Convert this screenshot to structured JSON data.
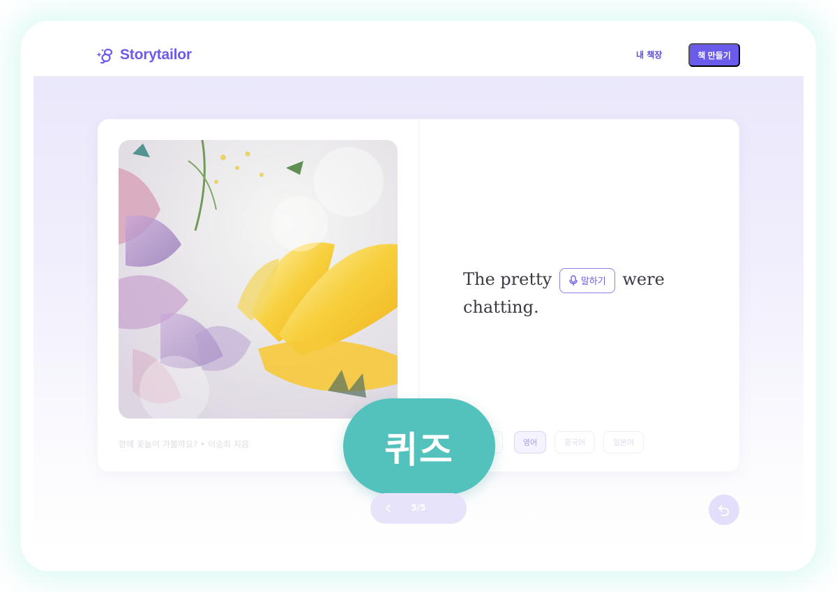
{
  "header": {
    "logo_text": "Storytailor",
    "nav_my_bookshelf": "내 책장",
    "nav_make_book": "책 만들기"
  },
  "book": {
    "caption": "함께 꽃놀이 가볼까요? • 이승희 지음",
    "sentence_before": "The pretty",
    "speak_label": "말하기",
    "sentence_after": "were chatting."
  },
  "languages": [
    {
      "label": "",
      "active": false
    },
    {
      "label": "영어",
      "active": true
    },
    {
      "label": "중국어",
      "active": false
    },
    {
      "label": "일본어",
      "active": false
    }
  ],
  "quiz": {
    "label": "퀴즈"
  },
  "pager": {
    "text": "5/5"
  },
  "colors": {
    "brand": "#6a5bea",
    "quiz": "#54c2bc",
    "accent_light": "#e6e3fb"
  },
  "icons": {
    "logo": "sparkle-bee-icon",
    "speak": "microphone-icon",
    "prev": "chevron-left-icon",
    "back": "undo-arrow-icon"
  }
}
